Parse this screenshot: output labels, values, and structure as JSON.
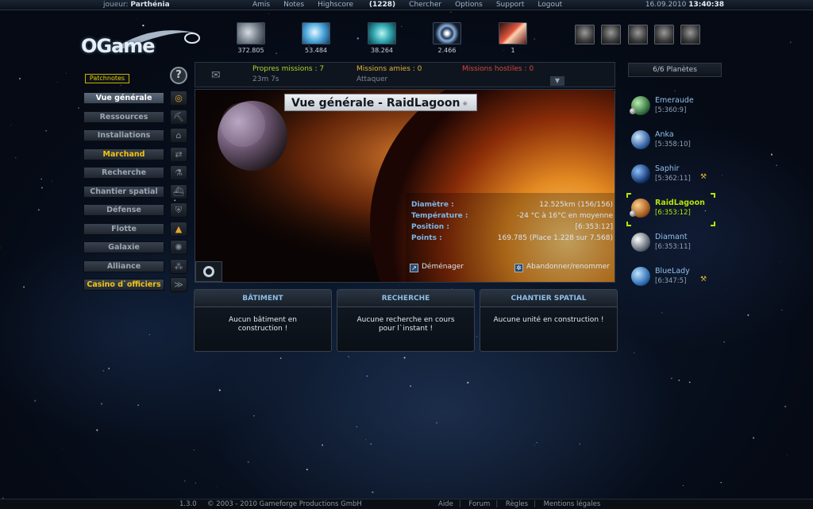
{
  "topbar": {
    "player_prefix": "joueur:",
    "player_name": "Parthénia",
    "menu": [
      "Amis",
      "Notes",
      "Highscore",
      "Chercher",
      "Options",
      "Support",
      "Logout"
    ],
    "highscore_rank": "(1228)",
    "date": "16.09.2010",
    "time": "13:40:38"
  },
  "logo": "OGame",
  "resources": [
    {
      "icon": "metal-icon",
      "value": "372.805",
      "color": "#9aa4ae"
    },
    {
      "icon": "crystal-icon",
      "value": "53.484",
      "color": "#5fb6e0"
    },
    {
      "icon": "deuterium-icon",
      "value": "38.264",
      "color": "#3fb8b8"
    },
    {
      "icon": "energy-icon",
      "value": "2.466",
      "color": "#6a8fb8"
    },
    {
      "icon": "dark-matter-icon",
      "value": "1",
      "color": "#d04a3a"
    }
  ],
  "officers": [
    "commander-portrait",
    "admiral-portrait",
    "engineer-portrait",
    "geologist-portrait",
    "technocrat-portrait"
  ],
  "left_menu": {
    "patchnotes": "Patchnotes",
    "items": [
      {
        "label": "Vue générale",
        "state": "active",
        "icon": "planet-ring-icon"
      },
      {
        "label": "Ressources",
        "state": "",
        "icon": "mine-icon"
      },
      {
        "label": "Installations",
        "state": "",
        "icon": "building-icon"
      },
      {
        "label": "Marchand",
        "state": "gold",
        "icon": "trade-arrows-icon"
      },
      {
        "label": "Recherche",
        "state": "",
        "icon": "flask-icon"
      },
      {
        "label": "Chantier spatial",
        "state": "",
        "icon": "shipyard-icon"
      },
      {
        "label": "Défense",
        "state": "",
        "icon": "defense-icon"
      },
      {
        "label": "Flotte",
        "state": "",
        "icon": "fleet-icon"
      },
      {
        "label": "Galaxie",
        "state": "",
        "icon": "galaxy-icon"
      },
      {
        "label": "Alliance",
        "state": "",
        "icon": "alliance-icon"
      },
      {
        "label": "Casino d`officiers",
        "state": "gold",
        "icon": "rank-chevrons-icon"
      }
    ]
  },
  "messages": {
    "own_missions": "Propres missions : 7",
    "own_timer": "23m 7s",
    "friendly_missions": "Missions amies : 0",
    "attack_label": "Attaquer",
    "hostile_missions": "Missions hostiles : 0"
  },
  "planet_count": "6/6 Planètes",
  "overview": {
    "title": "Vue générale - RaidLagoon",
    "details": [
      {
        "label": "Diamètre :",
        "value": "12.525km (156/156)"
      },
      {
        "label": "Température :",
        "value": "-24 °C à 16°C en moyenne"
      },
      {
        "label": "Position :",
        "value": "[6:353:12]"
      },
      {
        "label": "Points :",
        "value": "169.785 (Place 1.228 sur 7.568)"
      }
    ],
    "move_label": "Déménager",
    "abandon_label": "Abandonner/renommer"
  },
  "planets": [
    {
      "name": "Emeraude",
      "coords": "[5:360:9]",
      "color_a": "#b8f0b0",
      "color_b": "#2f6a3a",
      "moon": true,
      "wrench": false,
      "current": false
    },
    {
      "name": "Anka",
      "coords": "[5:358:10]",
      "color_a": "#cfe8ff",
      "color_b": "#2a5a9a",
      "moon": false,
      "wrench": false,
      "current": false
    },
    {
      "name": "Saphir",
      "coords": "[5:362:11]",
      "color_a": "#8ec2ff",
      "color_b": "#13356e",
      "moon": false,
      "wrench": true,
      "current": false
    },
    {
      "name": "RaidLagoon",
      "coords": "[6:353:12]",
      "color_a": "#ffd08a",
      "color_b": "#a0561c",
      "moon": true,
      "wrench": false,
      "current": true
    },
    {
      "name": "Diamant",
      "coords": "[6:353:11]",
      "color_a": "#ffffff",
      "color_b": "#5c6470",
      "moon": false,
      "wrench": false,
      "current": false
    },
    {
      "name": "BlueLady",
      "coords": "[6:347:5]",
      "color_a": "#bfe4ff",
      "color_b": "#2a6ab0",
      "moon": false,
      "wrench": true,
      "current": false
    }
  ],
  "construction": [
    {
      "title": "BÂTIMENT",
      "line1": "Aucun bâtiment en",
      "line2": "construction !"
    },
    {
      "title": "RECHERCHE",
      "line1": "Aucune recherche en cours",
      "line2": "pour l`instant !"
    },
    {
      "title": "CHANTIER SPATIAL",
      "line1": "Aucune unité en construction !",
      "line2": ""
    }
  ],
  "footer": {
    "version": "1.3.0",
    "copyright": "© 2003 - 2010 Gameforge Productions GmbH",
    "links": [
      "Aide",
      "Forum",
      "Règles",
      "Mentions légales"
    ]
  }
}
